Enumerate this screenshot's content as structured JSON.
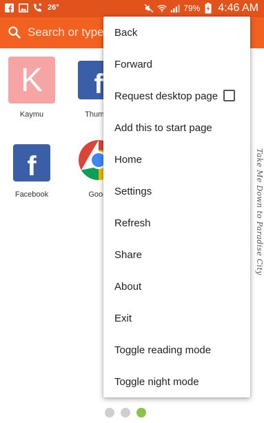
{
  "status_bar": {
    "temperature": "26°",
    "battery_percent": "79%",
    "time": "4:46 AM"
  },
  "search": {
    "placeholder": "Search or type URL"
  },
  "speed_dial": [
    {
      "label": "Kaymu",
      "letter": "K",
      "color": "#f7a4a4"
    },
    {
      "label": "Thumbs",
      "letter": "f",
      "color": "#3b5fa6"
    },
    {
      "label": "Facebook",
      "letter": "f",
      "color": "#3b5fa6"
    },
    {
      "label": "Googl",
      "icon": "google-chrome-icon"
    }
  ],
  "menu": {
    "items": [
      {
        "label": "Back"
      },
      {
        "label": "Forward"
      },
      {
        "label": "Request desktop page",
        "checkbox": false
      },
      {
        "label": "Add this to start page"
      },
      {
        "label": "Home"
      },
      {
        "label": "Settings"
      },
      {
        "label": "Refresh"
      },
      {
        "label": "Share"
      },
      {
        "label": "About"
      },
      {
        "label": "Exit"
      },
      {
        "label": "Toggle reading mode"
      },
      {
        "label": "Toggle night mode"
      }
    ]
  },
  "pager": {
    "page_count": 3,
    "active_page": 3
  },
  "watermark": "Take Me Down to Paradise City",
  "colors": {
    "status_bar": "#e2531c",
    "search_bar": "#f2611f",
    "active_dot": "#8bc34a",
    "inactive_dot": "#cfcfcf"
  }
}
